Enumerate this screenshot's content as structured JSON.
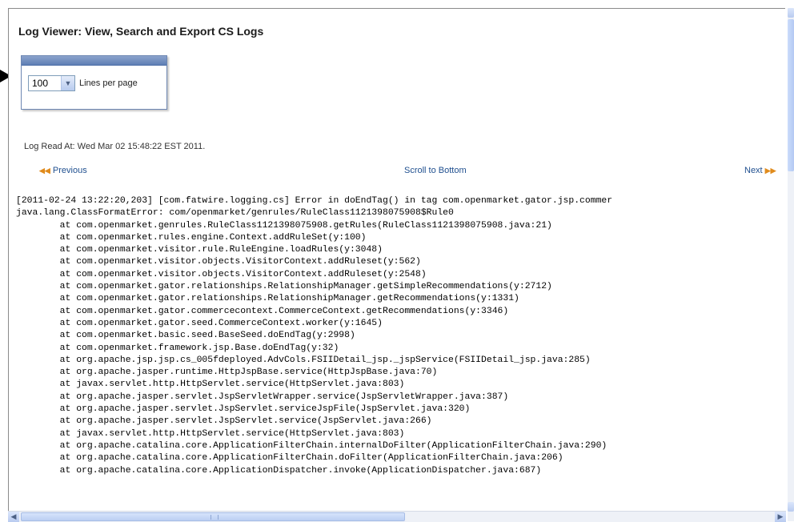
{
  "page": {
    "title": "Log Viewer: View, Search and Export CS Logs"
  },
  "pager": {
    "lines_value": "100",
    "lines_label": "Lines per page"
  },
  "log_read": "Log Read At: Wed Mar 02 15:48:22 EST 2011.",
  "nav": {
    "previous": "Previous",
    "scroll_to_bottom": "Scroll to Bottom",
    "next": "Next"
  },
  "icons": {
    "previous": "double-chevron-left-icon",
    "next": "double-chevron-right-icon",
    "dropdown": "chevron-down-icon",
    "pointer": "arrow-pointer-icon"
  },
  "colors": {
    "link": "#1f4f8f",
    "chevron": "#e08b1c",
    "header_bar": "#5f7fb5"
  },
  "log_lines": [
    "[2011-02-24 13:22:20,203] [com.fatwire.logging.cs] Error in doEndTag() in tag com.openmarket.gator.jsp.commer",
    "java.lang.ClassFormatError: com/openmarket/genrules/RuleClass1121398075908$Rule0",
    "        at com.openmarket.genrules.RuleClass1121398075908.getRules(RuleClass1121398075908.java:21)",
    "        at com.openmarket.rules.engine.Context.addRuleSet(y:100)",
    "        at com.openmarket.visitor.rule.RuleEngine.loadRules(y:3048)",
    "        at com.openmarket.visitor.objects.VisitorContext.addRuleset(y:562)",
    "        at com.openmarket.visitor.objects.VisitorContext.addRuleset(y:2548)",
    "        at com.openmarket.gator.relationships.RelationshipManager.getSimpleRecommendations(y:2712)",
    "        at com.openmarket.gator.relationships.RelationshipManager.getRecommendations(y:1331)",
    "        at com.openmarket.gator.commercecontext.CommerceContext.getRecommendations(y:3346)",
    "        at com.openmarket.gator.seed.CommerceContext.worker(y:1645)",
    "        at com.openmarket.basic.seed.BaseSeed.doEndTag(y:2998)",
    "        at com.openmarket.framework.jsp.Base.doEndTag(y:32)",
    "        at org.apache.jsp.jsp.cs_005fdeployed.AdvCols.FSIIDetail_jsp._jspService(FSIIDetail_jsp.java:285)",
    "        at org.apache.jasper.runtime.HttpJspBase.service(HttpJspBase.java:70)",
    "        at javax.servlet.http.HttpServlet.service(HttpServlet.java:803)",
    "        at org.apache.jasper.servlet.JspServletWrapper.service(JspServletWrapper.java:387)",
    "        at org.apache.jasper.servlet.JspServlet.serviceJspFile(JspServlet.java:320)",
    "        at org.apache.jasper.servlet.JspServlet.service(JspServlet.java:266)",
    "        at javax.servlet.http.HttpServlet.service(HttpServlet.java:803)",
    "        at org.apache.catalina.core.ApplicationFilterChain.internalDoFilter(ApplicationFilterChain.java:290)",
    "        at org.apache.catalina.core.ApplicationFilterChain.doFilter(ApplicationFilterChain.java:206)",
    "        at org.apache.catalina.core.ApplicationDispatcher.invoke(ApplicationDispatcher.java:687)"
  ]
}
